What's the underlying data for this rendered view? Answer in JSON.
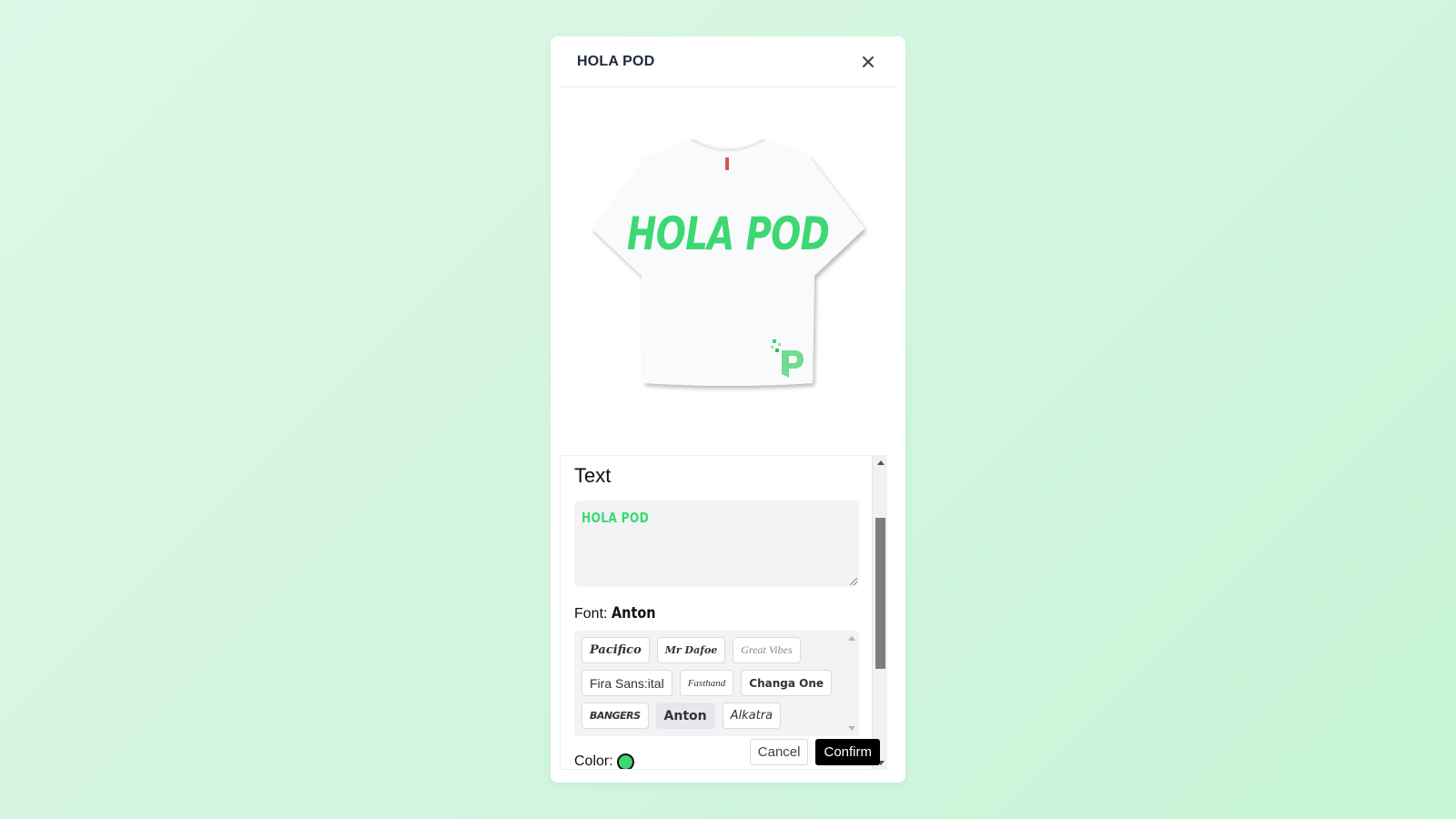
{
  "modal": {
    "title": "HOLA POD",
    "close_icon": "close-icon"
  },
  "preview": {
    "product": "t-shirt",
    "shirt_color": "#ffffff",
    "print_text": "HOLA POD",
    "print_color": "#3dd873",
    "logo": "P-logo"
  },
  "editor": {
    "section_title": "Text",
    "text_value": "HOLA POD",
    "font_label": "Font:",
    "font_current": "Anton",
    "fonts": [
      {
        "label": "Pacifico",
        "cls": "fc-pacifico",
        "selected": false
      },
      {
        "label": "Mr Dafoe",
        "cls": "fc-mrdafoe",
        "selected": false
      },
      {
        "label": "Great Vibes",
        "cls": "fc-greatvibes",
        "selected": false
      },
      {
        "label": "Fira Sans:ital",
        "cls": "fc-fira",
        "selected": false
      },
      {
        "label": "Fasthand",
        "cls": "fc-fasthand",
        "selected": false
      },
      {
        "label": "Changa One",
        "cls": "fc-changa",
        "selected": false
      },
      {
        "label": "BANGERS",
        "cls": "fc-bangers",
        "selected": false
      },
      {
        "label": "Anton",
        "cls": "fc-anton",
        "selected": true
      },
      {
        "label": "Alkatra",
        "cls": "fc-alkatra",
        "selected": false
      }
    ],
    "color_label": "Color:",
    "color_current": "#3dd873",
    "swatches": [
      {
        "color": "#dbe4f0",
        "selected": false
      },
      {
        "color": "#ef6b6b",
        "selected": false
      },
      {
        "color": "#64748b",
        "selected": false
      },
      {
        "color": "#3dd873",
        "selected": true
      },
      {
        "color": "#22cce6",
        "selected": false
      },
      {
        "color": "#4b4b4b",
        "selected": false
      },
      {
        "color": "#dde46b",
        "selected": false
      },
      {
        "color": "#fb8355",
        "selected": false
      }
    ]
  },
  "footer": {
    "cancel_label": "Cancel",
    "confirm_label": "Confirm"
  }
}
